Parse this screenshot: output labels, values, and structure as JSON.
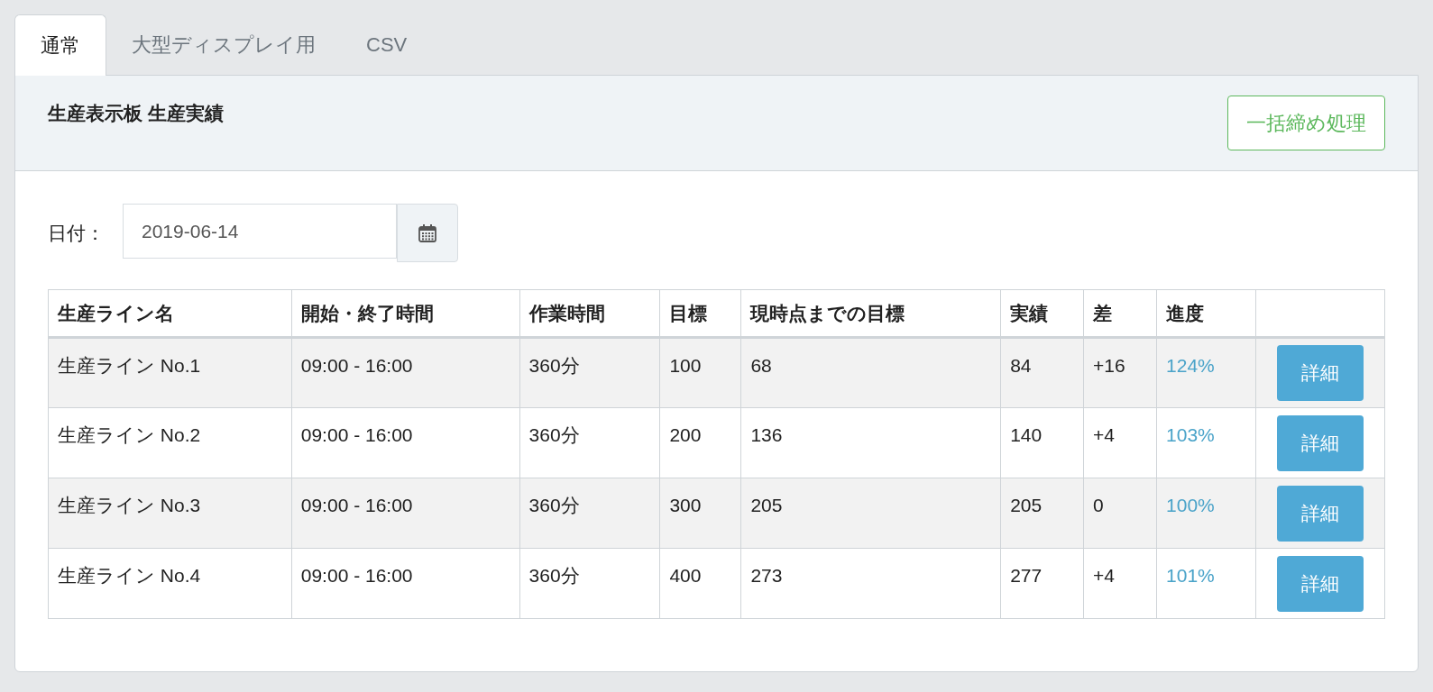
{
  "tabs": [
    {
      "label": "通常",
      "selected": true
    },
    {
      "label": "大型ディスプレイ用",
      "selected": false
    },
    {
      "label": "CSV",
      "selected": false
    }
  ],
  "panel": {
    "title": "生産表示板 生産実績",
    "action_button": "一括締め処理"
  },
  "date_filter": {
    "label": "日付：",
    "value": "2019-06-14"
  },
  "table": {
    "columns": [
      "生産ライン名",
      "開始・終了時間",
      "作業時間",
      "目標",
      "現時点までの目標",
      "実績",
      "差",
      "進度"
    ],
    "rows": [
      {
        "cells": [
          "生産ライン No.1",
          "09:00 - 16:00",
          "360分",
          "100",
          "68",
          "84",
          "+16",
          "124%"
        ],
        "button": "詳細"
      },
      {
        "cells": [
          "生産ライン No.2",
          "09:00 - 16:00",
          "360分",
          "200",
          "136",
          "140",
          "+4",
          "103%"
        ],
        "button": "詳細"
      },
      {
        "cells": [
          "生産ライン No.3",
          "09:00 - 16:00",
          "360分",
          "300",
          "205",
          "205",
          "0",
          "100%"
        ],
        "button": "詳細"
      },
      {
        "cells": [
          "生産ライン No.4",
          "09:00 - 16:00",
          "360分",
          "400",
          "273",
          "277",
          "+4",
          "101%"
        ],
        "button": "詳細"
      }
    ]
  }
}
